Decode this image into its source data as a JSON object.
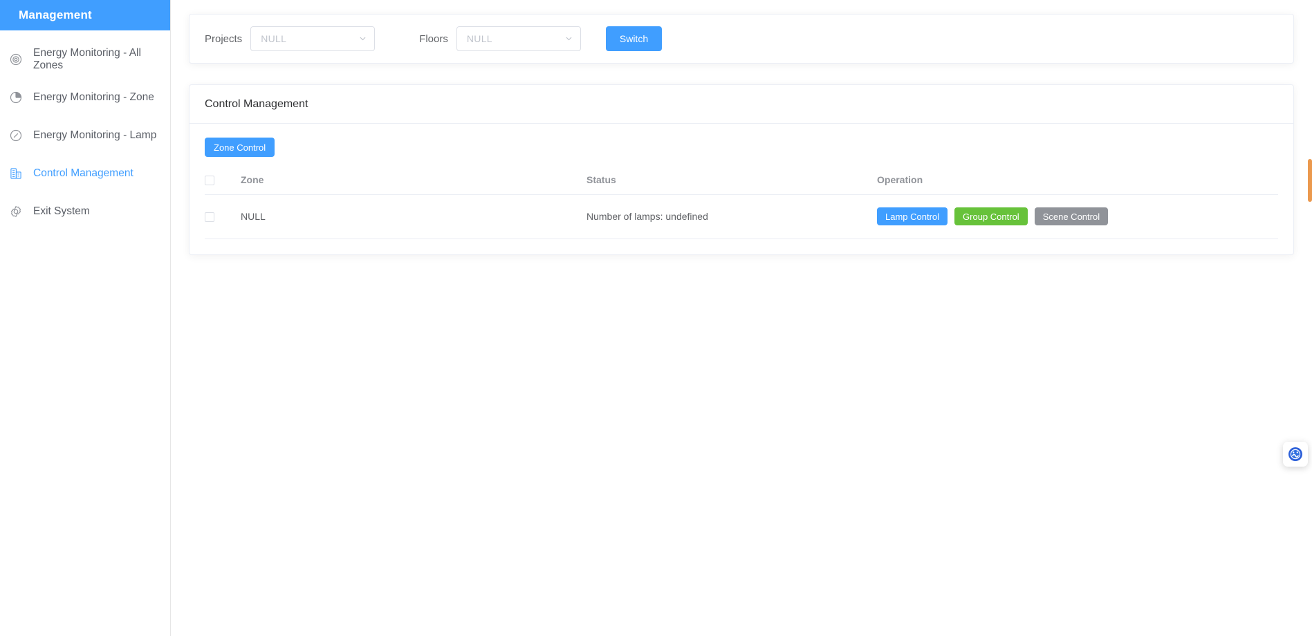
{
  "sidebar": {
    "title": "Management",
    "items": [
      {
        "label": "Energy Monitoring - All Zones",
        "icon": "target-circle-icon",
        "active": false
      },
      {
        "label": "Energy Monitoring - Zone",
        "icon": "pie-chart-icon",
        "active": false
      },
      {
        "label": "Energy Monitoring - Lamp",
        "icon": "compass-icon",
        "active": false
      },
      {
        "label": "Control Management",
        "icon": "building-icon",
        "active": true
      },
      {
        "label": "Exit System",
        "icon": "gear-icon",
        "active": false
      }
    ]
  },
  "filter_bar": {
    "projects_label": "Projects",
    "projects_value": "",
    "projects_placeholder": "NULL",
    "floors_label": "Floors",
    "floors_value": "",
    "floors_placeholder": "NULL",
    "switch_label": "Switch"
  },
  "panel": {
    "title": "Control Management",
    "zone_control_label": "Zone Control"
  },
  "table": {
    "headers": {
      "select_all": "",
      "zone": "Zone",
      "status": "Status",
      "operation": "Operation"
    },
    "rows": [
      {
        "zone": "NULL",
        "status": "Number of lamps: undefined",
        "ops": {
          "lamp": "Lamp Control",
          "group": "Group Control",
          "scene": "Scene Control"
        }
      }
    ]
  },
  "widgets": {
    "float_badge": "assistant-badge-icon"
  },
  "colors": {
    "brand_blue": "#409EFF",
    "success_green": "#67C23A",
    "neutral_gray": "#909399",
    "scroll_orange": "#e8872f"
  }
}
